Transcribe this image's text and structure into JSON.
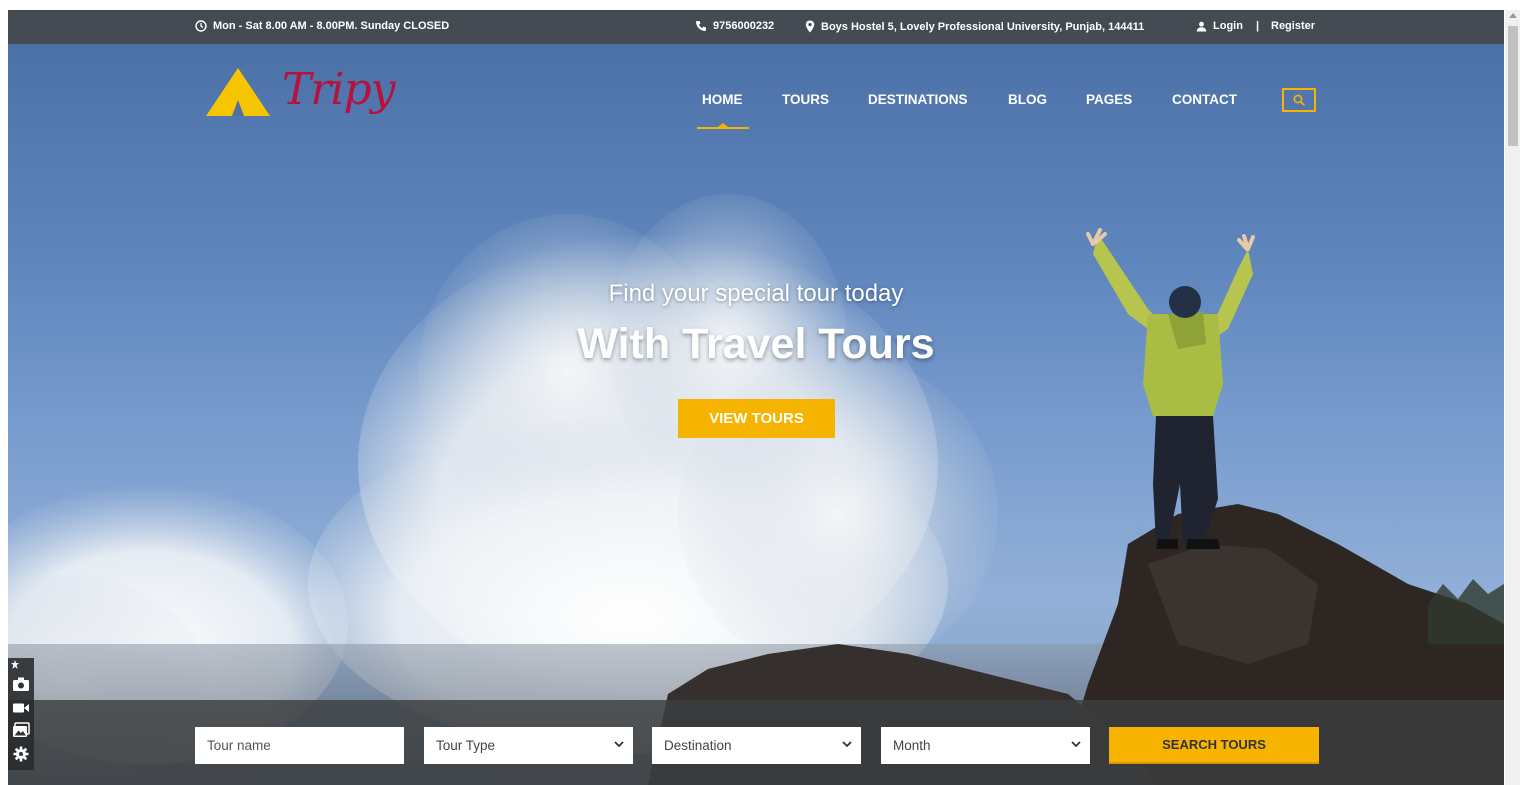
{
  "topbar": {
    "hours": "Mon - Sat 8.00 AM - 8.00PM. Sunday CLOSED",
    "phone": "9756000232",
    "address": "Boys Hostel 5, Lovely Professional University, Punjab, 144411",
    "login": "Login",
    "separator": "|",
    "register": "Register"
  },
  "brand": {
    "name": "Tripy",
    "logo_color": "#f6c500",
    "name_color": "#b5123d"
  },
  "nav": {
    "items": [
      "HOME",
      "TOURS",
      "DESTINATIONS",
      "BLOG",
      "PAGES",
      "CONTACT"
    ],
    "active": "HOME",
    "search_icon": "search-icon"
  },
  "hero": {
    "subtitle": "Find your special tour today",
    "title": "With Travel Tours",
    "cta": "VIEW TOURS"
  },
  "search": {
    "tour_name_placeholder": "Tour name",
    "tour_type": "Tour Type",
    "destination": "Destination",
    "month": "Month",
    "button": "SEARCH TOURS"
  },
  "colors": {
    "accent": "#f6b400",
    "topbar": "#444b52"
  },
  "side_tools": [
    "pin-icon",
    "camera-icon",
    "video-icon",
    "gallery-icon",
    "gear-icon"
  ]
}
